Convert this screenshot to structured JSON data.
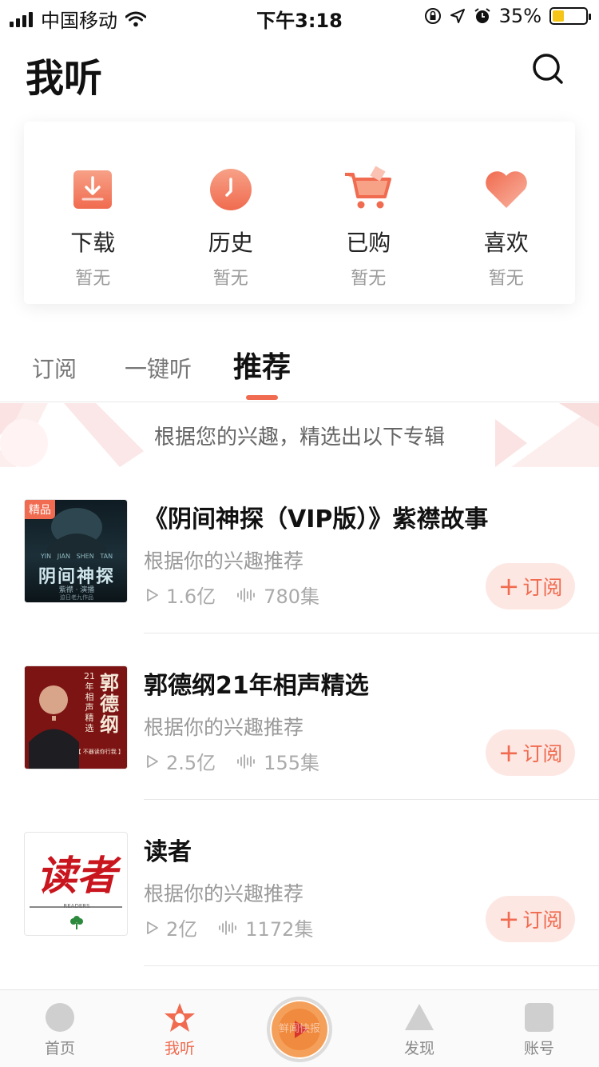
{
  "status_bar": {
    "carrier": "中国移动",
    "time": "下午3:18",
    "battery_percent": "35%",
    "battery_level": 0.35
  },
  "header": {
    "title": "我听",
    "search_icon": "search-icon"
  },
  "quick_access": [
    {
      "label": "下载",
      "sub": "暂无",
      "icon": "download-icon"
    },
    {
      "label": "历史",
      "sub": "暂无",
      "icon": "clock-icon"
    },
    {
      "label": "已购",
      "sub": "暂无",
      "icon": "cart-icon"
    },
    {
      "label": "喜欢",
      "sub": "暂无",
      "icon": "heart-icon"
    }
  ],
  "tabs": [
    {
      "label": "订阅",
      "active": false
    },
    {
      "label": "一键听",
      "active": false
    },
    {
      "label": "推荐",
      "active": true
    }
  ],
  "banner": {
    "text": "根据您的兴趣，精选出以下专辑"
  },
  "albums": [
    {
      "title": "《阴间神探（VIP版）》紫襟故事",
      "reason": "根据你的兴趣推荐",
      "plays": "1.6亿",
      "episodes": "780集",
      "badge": "精品",
      "cover_title": "阴间神探",
      "cover_pinyin": "YIN   JIAN   SHEN   TAN",
      "cover_author": "紫襟 · 演播",
      "cover_note": "迫日老九作品",
      "subscribe_label": "订阅"
    },
    {
      "title": "郭德纲21年相声精选",
      "reason": "根据你的兴趣推荐",
      "plays": "2.5亿",
      "episodes": "155集",
      "cover_title": "郭德纲",
      "cover_sub": "21年相声精选",
      "cover_note": "【 不器读你行我 】",
      "subscribe_label": "订阅"
    },
    {
      "title": "读者",
      "reason": "根据你的兴趣推荐",
      "plays": "2亿",
      "episodes": "1172集",
      "cover_title": "读者",
      "cover_sub": "READERS",
      "subscribe_label": "订阅"
    }
  ],
  "bottom_nav": [
    {
      "label": "首页",
      "icon": "home-icon",
      "active": false
    },
    {
      "label": "我听",
      "icon": "star-icon",
      "active": true
    },
    {
      "label": "鲜闻快报",
      "icon": "play-icon",
      "active": false
    },
    {
      "label": "发现",
      "icon": "triangle-icon",
      "active": false
    },
    {
      "label": "账号",
      "icon": "account-icon",
      "active": false
    }
  ],
  "colors": {
    "accent": "#f06b4f",
    "subscribe_bg": "#fde7e3",
    "muted": "#999999"
  }
}
